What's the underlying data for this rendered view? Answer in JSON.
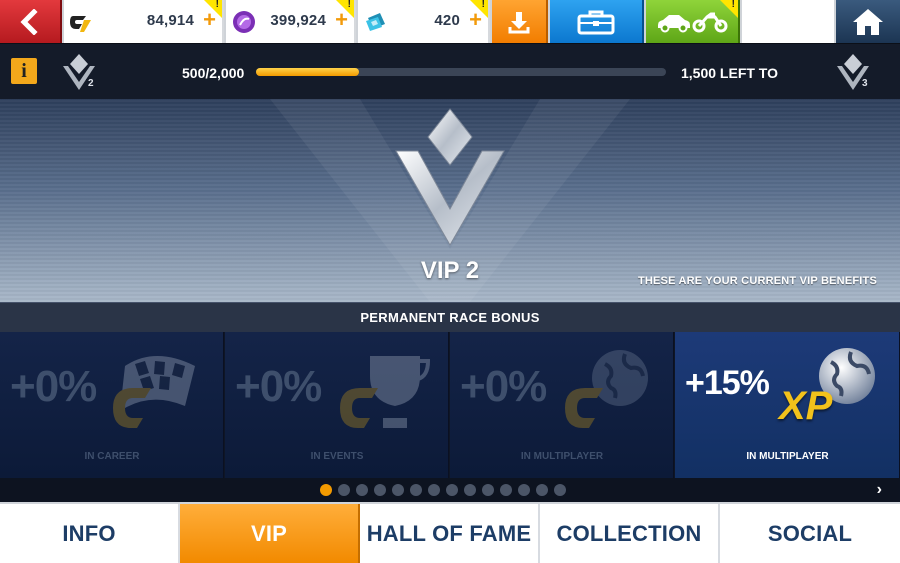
{
  "topbar": {
    "credits": "84,914",
    "tokens": "399,924",
    "cards": "420",
    "plus": "+",
    "warning": "!"
  },
  "progress": {
    "current": "500/2,000",
    "remaining": "1,500 LEFT TO",
    "fraction": 0.25,
    "info_glyph": "i",
    "level_current": "2",
    "level_next": "3"
  },
  "hero": {
    "title": "VIP 2",
    "note": "THESE ARE YOUR CURRENT VIP BENEFITS"
  },
  "section": {
    "title": "PERMANENT RACE BONUS"
  },
  "bonuses": [
    {
      "value": "+0%",
      "caption": "IN CAREER"
    },
    {
      "value": "+0%",
      "caption": "IN EVENTS"
    },
    {
      "value": "+0%",
      "caption": "IN MULTIPLAYER"
    },
    {
      "value": "+15%",
      "caption": "IN MULTIPLAYER",
      "badge": "XP"
    }
  ],
  "pager": {
    "total": 14,
    "active": 0,
    "next_glyph": "›"
  },
  "tabs": [
    {
      "label": "INFO"
    },
    {
      "label": "VIP"
    },
    {
      "label": "HALL OF FAME"
    },
    {
      "label": "COLLECTION"
    },
    {
      "label": "SOCIAL"
    }
  ],
  "colors": {
    "accent": "#f39a00",
    "back": "#d42a2f",
    "download": "#f59015",
    "toolbox": "#1a8fe0",
    "garage": "#76c02a",
    "home": "#2b4769",
    "tab_text": "#1d3d66"
  },
  "icons": [
    "back-arrow-icon",
    "credits-icon",
    "tokens-icon",
    "cards-icon",
    "download-icon",
    "toolbox-icon",
    "car-icon",
    "motorbike-icon",
    "home-icon",
    "info-icon",
    "vip-badge-icon",
    "checkered-flag-icon",
    "trophy-icon",
    "globe-icon"
  ]
}
